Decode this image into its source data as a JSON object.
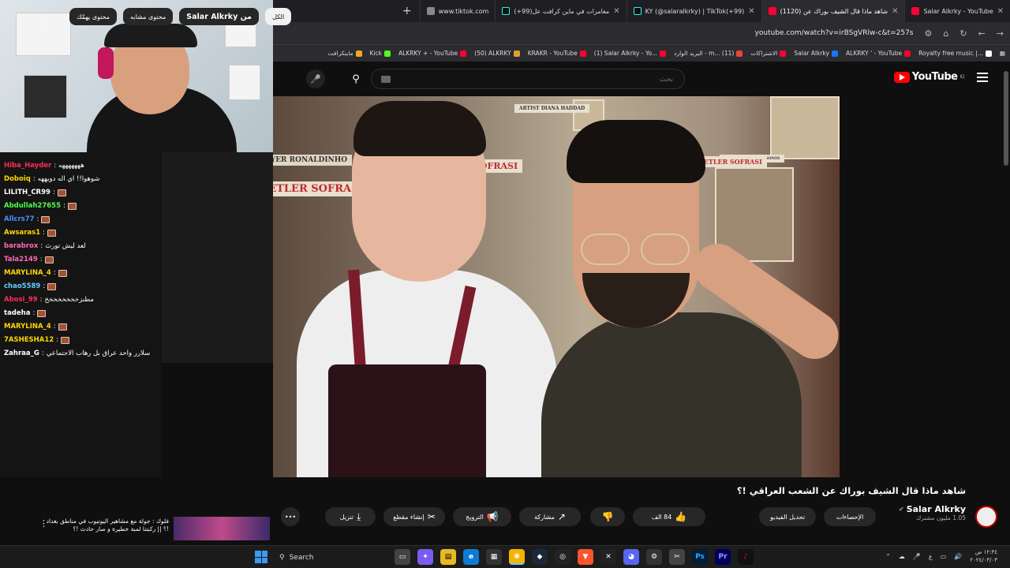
{
  "browser": {
    "tabs": [
      {
        "title": "Salar Alkrky - YouTube",
        "icon": "youtube-icon",
        "active": false
      },
      {
        "title": "(1120) شاهد ماذا قال الشيف بوراك عن",
        "icon": "youtube-icon",
        "active": true
      },
      {
        "title": "KY (@salaralkrky) | TikTok(+99)",
        "icon": "tiktok-icon",
        "active": false
      },
      {
        "title": "(+99)مغامرات في ماين كرافت عل",
        "icon": "tiktok-icon",
        "active": false
      },
      {
        "title": "www.tiktok.com",
        "icon": "globe-icon",
        "active": false
      }
    ],
    "url": "youtube.com/watch?v=irBSgVRlw-c&t=257s",
    "bookmarks": [
      {
        "label": "Royalty free music |...",
        "color": "#ffffff"
      },
      {
        "label": "ALKRKY ' - YouTube",
        "color": "#ff0033"
      },
      {
        "label": "Salar Alkrky",
        "color": "#1877f2"
      },
      {
        "label": "الاشتراكات",
        "color": "#ff0033"
      },
      {
        "label": "البريد الوارد - m... (11)",
        "color": "#ea4335"
      },
      {
        "label": "(1) Salar Alkrky - Yo...",
        "color": "#ff0033"
      },
      {
        "label": "KRAKR - YouTube",
        "color": "#ff0033"
      },
      {
        "label": "(50) ALKRKY",
        "color": "#e0a030"
      },
      {
        "label": "ALKRKY + - YouTube",
        "color": "#ff0033"
      },
      {
        "label": "Kick",
        "color": "#53fc18"
      },
      {
        "label": "ماينكرافت",
        "color": "#f5a623"
      }
    ]
  },
  "youtube": {
    "logo_text": "YouTube",
    "logo_sup": "IQ",
    "search_placeholder": "بحث",
    "video_title": "شاهد ماذا قال الشيف بوراك عن الشعب العراقي !؟",
    "video_signs": [
      "FOOTBALL PLAYER RONALDINHO",
      "SOFRASI",
      "EDENIYETLER SOFRASI",
      "ARTIST DIANA HADDAD",
      "ACTOR SHRAIAM SONIS",
      "EYETLER SOFRASI"
    ],
    "channel_name": "Salar Alkrky",
    "channel_subs": "1.05 مليون مشترك",
    "buttons": {
      "stats": "الإحصاءات",
      "edit": "تحديل الفيديو",
      "likes": "84 الف",
      "share": "مشاركة",
      "promote": "الترويج",
      "clip": "إنشاء مقطع",
      "download": "تنزيل"
    },
    "chips": [
      {
        "label": "الكل",
        "active": true
      },
      {
        "label": "من Salar Alkrky",
        "active": false,
        "bold": "Salar Alkrky"
      },
      {
        "label": "محتوى مشابه",
        "active": false
      },
      {
        "label": "محتوى يهمّك",
        "active": false
      }
    ],
    "recommended": {
      "title": "فلوك : جولة مع مشاهير اليوتيوب في مناطق بغداد !؟ || ركبتنا لمبة خطيرة و صار حادث !؟"
    }
  },
  "chat": [
    {
      "user": "Hiba_Hayder",
      "color": "#ff2d55",
      "message": "هههههههه",
      "emote": false
    },
    {
      "user": "Doboiq",
      "color": "#ffd700",
      "message": "شوهوا!! اي اله دويههه",
      "emote": false
    },
    {
      "user": "LILITH_CR99",
      "color": "#ffffff",
      "message": "",
      "emote": true
    },
    {
      "user": "Abdullah27655",
      "color": "#4cff4c",
      "message": "",
      "emote": true
    },
    {
      "user": "Allcrs77",
      "color": "#4a90ff",
      "message": "",
      "emote": true
    },
    {
      "user": "Awsaras1",
      "color": "#ffd700",
      "message": "",
      "emote": true
    },
    {
      "user": "barabrox",
      "color": "#ff69b4",
      "message": "لعد ليش تورث",
      "emote": false
    },
    {
      "user": "Tala2149",
      "color": "#ff69b4",
      "message": "",
      "emote": true
    },
    {
      "user": "MARYLINA_4",
      "color": "#ffd700",
      "message": "",
      "emote": true
    },
    {
      "user": "chao5589",
      "color": "#66ccff",
      "message": "",
      "emote": true
    },
    {
      "user": "Abosi_99",
      "color": "#ff2d55",
      "message": "مطنزخخخخخخخخ",
      "emote": false
    },
    {
      "user": "tadeha",
      "color": "#ffffff",
      "message": "",
      "emote": true
    },
    {
      "user": "MARYLINA_4",
      "color": "#ffd700",
      "message": "",
      "emote": true
    },
    {
      "user": "7ASHESHA12",
      "color": "#ffd700",
      "message": "",
      "emote": true
    },
    {
      "user": "Zahraa_G",
      "color": "#ffffff",
      "message": "سلارر واحد عراق بل رهاب الاجتماعي",
      "emote": false
    }
  ],
  "taskbar": {
    "search_label": "Search",
    "time": "١٢:٣٤ ص",
    "date": "٢٠٢٤/٠٣/٠٣",
    "lang": "ع"
  }
}
